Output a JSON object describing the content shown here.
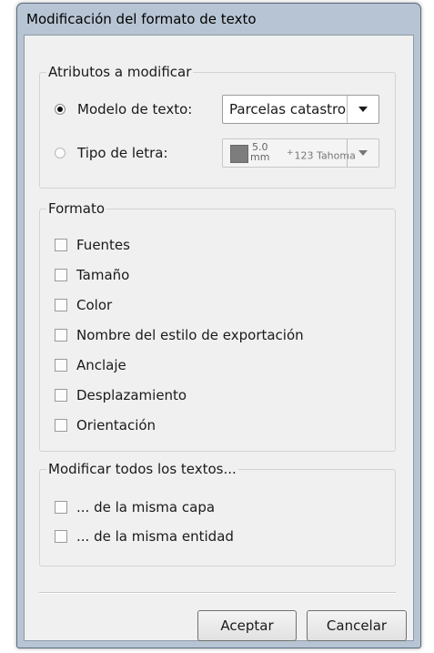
{
  "window": {
    "title": "Modificación del formato de texto"
  },
  "attributes": {
    "legend": "Atributos a modificar",
    "text_model": {
      "label": "Modelo de texto:",
      "selected": true,
      "value": "Parcelas catastro"
    },
    "font_type": {
      "label": "Tipo de letra:",
      "selected": false,
      "size_top": "5.0",
      "size_unit": "mm",
      "font_prefix": "+",
      "font_name": "123 Tahoma"
    }
  },
  "format": {
    "legend": "Formato",
    "items": [
      {
        "label": "Fuentes",
        "checked": false
      },
      {
        "label": "Tamaño",
        "checked": false
      },
      {
        "label": "Color",
        "checked": false
      },
      {
        "label": "Nombre del estilo de exportación",
        "checked": false
      },
      {
        "label": "Anclaje",
        "checked": false
      },
      {
        "label": "Desplazamiento",
        "checked": false
      },
      {
        "label": "Orientación",
        "checked": false
      }
    ]
  },
  "modify_all": {
    "legend": "Modificar todos los textos...",
    "items": [
      {
        "label": "... de la misma capa",
        "checked": false
      },
      {
        "label": "... de la misma entidad",
        "checked": false
      }
    ]
  },
  "buttons": {
    "accept": "Aceptar",
    "cancel": "Cancelar"
  }
}
